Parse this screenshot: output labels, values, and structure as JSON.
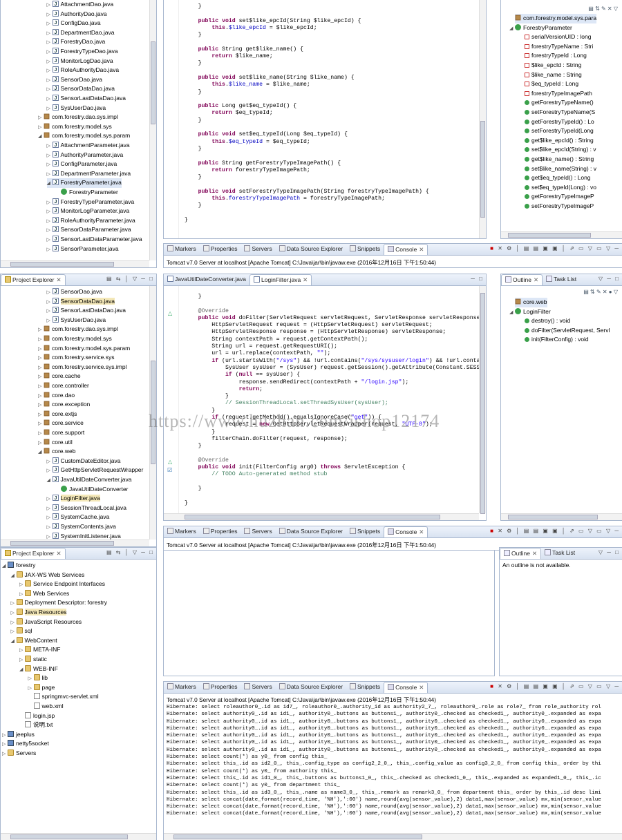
{
  "pe1": {
    "items": [
      {
        "label": "AttachmentDao.java",
        "type": "j",
        "indent": 5
      },
      {
        "label": "AuthorityDao.java",
        "type": "j",
        "indent": 5
      },
      {
        "label": "ConfigDao.java",
        "type": "j",
        "indent": 5
      },
      {
        "label": "DepartmentDao.java",
        "type": "j",
        "indent": 5
      },
      {
        "label": "ForestryDao.java",
        "type": "j",
        "indent": 5
      },
      {
        "label": "ForestryTypeDao.java",
        "type": "j",
        "indent": 5
      },
      {
        "label": "MonitorLogDao.java",
        "type": "j",
        "indent": 5
      },
      {
        "label": "RoleAuthorityDao.java",
        "type": "j",
        "indent": 5
      },
      {
        "label": "SensorDao.java",
        "type": "j",
        "indent": 5
      },
      {
        "label": "SensorDataDao.java",
        "type": "j",
        "indent": 5
      },
      {
        "label": "SensorLastDataDao.java",
        "type": "j",
        "indent": 5
      },
      {
        "label": "SysUserDao.java",
        "type": "j",
        "indent": 5
      },
      {
        "label": "com.forestry.dao.sys.impl",
        "type": "pk",
        "indent": 4
      },
      {
        "label": "com.forestry.model.sys",
        "type": "pk",
        "indent": 4
      },
      {
        "label": "com.forestry.model.sys.param",
        "type": "pk",
        "indent": 4,
        "open": true
      },
      {
        "label": "AttachmentParameter.java",
        "type": "j",
        "indent": 5
      },
      {
        "label": "AuthorityParameter.java",
        "type": "j",
        "indent": 5
      },
      {
        "label": "ConfigParameter.java",
        "type": "j",
        "indent": 5
      },
      {
        "label": "DepartmentParameter.java",
        "type": "j",
        "indent": 5
      },
      {
        "label": "ForestryParameter.java",
        "type": "j",
        "indent": 5,
        "open": true,
        "sel": true
      },
      {
        "label": "ForestryParameter",
        "type": "cls",
        "indent": 6
      },
      {
        "label": "ForestryTypeParameter.java",
        "type": "j",
        "indent": 5
      },
      {
        "label": "MonitorLogParameter.java",
        "type": "j",
        "indent": 5
      },
      {
        "label": "RoleAuthorityParameter.java",
        "type": "j",
        "indent": 5
      },
      {
        "label": "SensorDataParameter.java",
        "type": "j",
        "indent": 5
      },
      {
        "label": "SensorLastDataParameter.java",
        "type": "j",
        "indent": 5
      },
      {
        "label": "SensorParameter.java",
        "type": "j",
        "indent": 5
      }
    ]
  },
  "editor1": {
    "lines": [
      "    }",
      "",
      "    public void set$like_epcId(String $like_epcId) {",
      "        this.$like_epcId = $like_epcId;",
      "    }",
      "",
      "    public String get$like_name() {",
      "        return $like_name;",
      "    }",
      "",
      "    public void set$like_name(String $like_name) {",
      "        this.$like_name = $like_name;",
      "    }",
      "",
      "    public Long get$eq_typeId() {",
      "        return $eq_typeId;",
      "    }",
      "",
      "    public void set$eq_typeId(Long $eq_typeId) {",
      "        this.$eq_typeId = $eq_typeId;",
      "    }",
      "",
      "    public String getForestryTypeImagePath() {",
      "        return forestryTypeImagePath;",
      "    }",
      "",
      "    public void setForestryTypeImagePath(String forestryTypeImagePath) {",
      "        this.forestryTypeImagePath = forestryTypeImagePath;",
      "    }",
      "",
      "}"
    ]
  },
  "outline1": {
    "items": [
      {
        "label": "com.forestry.model.sys.para",
        "kind": "pkg",
        "indent": 0,
        "sel": true
      },
      {
        "label": "ForestryParameter",
        "kind": "cls",
        "indent": 0
      },
      {
        "label": "serialVersionUID : long",
        "kind": "fld",
        "indent": 1
      },
      {
        "label": "forestryTypeName : Stri",
        "kind": "fld",
        "indent": 1
      },
      {
        "label": "forestryTypeId : Long",
        "kind": "fld",
        "indent": 1
      },
      {
        "label": "$like_epcId : String",
        "kind": "fld",
        "indent": 1
      },
      {
        "label": "$like_name : String",
        "kind": "fld",
        "indent": 1
      },
      {
        "label": "$eq_typeId : Long",
        "kind": "fld",
        "indent": 1
      },
      {
        "label": "forestryTypeImagePath",
        "kind": "fld",
        "indent": 1
      },
      {
        "label": "getForestryTypeName()",
        "kind": "meth",
        "indent": 1
      },
      {
        "label": "setForestryTypeName(S",
        "kind": "meth",
        "indent": 1
      },
      {
        "label": "getForestryTypeId() : Lo",
        "kind": "meth",
        "indent": 1
      },
      {
        "label": "setForestryTypeId(Long",
        "kind": "meth",
        "indent": 1
      },
      {
        "label": "get$like_epcId() : String",
        "kind": "meth",
        "indent": 1
      },
      {
        "label": "set$like_epcId(String) : v",
        "kind": "meth",
        "indent": 1
      },
      {
        "label": "get$like_name() : String",
        "kind": "meth",
        "indent": 1
      },
      {
        "label": "set$like_name(String) : v",
        "kind": "meth",
        "indent": 1
      },
      {
        "label": "get$eq_typeId() : Long",
        "kind": "meth",
        "indent": 1
      },
      {
        "label": "set$eq_typeId(Long) : vo",
        "kind": "meth",
        "indent": 1
      },
      {
        "label": "getForestryTypeImageP",
        "kind": "meth",
        "indent": 1
      },
      {
        "label": "setForestryTypeImageP",
        "kind": "meth",
        "indent": 1
      }
    ]
  },
  "consoleTabs": [
    "Markers",
    "Properties",
    "Servers",
    "Data Source Explorer",
    "Snippets",
    "Console"
  ],
  "consoleHeader": "Tomcat v7.0 Server at localhost [Apache Tomcat] C:\\Java\\jar\\bin\\javaw.exe (2016年12月16日 下午1:50:44)",
  "pe2": {
    "title": "Project Explorer",
    "items": [
      {
        "label": "SensorDao.java",
        "type": "j",
        "indent": 5
      },
      {
        "label": "SensorDataDao.java",
        "type": "j",
        "indent": 5,
        "hl": true
      },
      {
        "label": "SensorLastDataDao.java",
        "type": "j",
        "indent": 5
      },
      {
        "label": "SysUserDao.java",
        "type": "j",
        "indent": 5
      },
      {
        "label": "com.forestry.dao.sys.impl",
        "type": "pk",
        "indent": 4
      },
      {
        "label": "com.forestry.model.sys",
        "type": "pk",
        "indent": 4
      },
      {
        "label": "com.forestry.model.sys.param",
        "type": "pk",
        "indent": 4
      },
      {
        "label": "com.forestry.service.sys",
        "type": "pk",
        "indent": 4
      },
      {
        "label": "com.forestry.service.sys.impl",
        "type": "pk",
        "indent": 4
      },
      {
        "label": "core.cache",
        "type": "pk",
        "indent": 4
      },
      {
        "label": "core.controller",
        "type": "pk",
        "indent": 4
      },
      {
        "label": "core.dao",
        "type": "pk",
        "indent": 4
      },
      {
        "label": "core.exception",
        "type": "pk",
        "indent": 4
      },
      {
        "label": "core.extjs",
        "type": "pk",
        "indent": 4
      },
      {
        "label": "core.service",
        "type": "pk",
        "indent": 4
      },
      {
        "label": "core.support",
        "type": "pk",
        "indent": 4
      },
      {
        "label": "core.util",
        "type": "pk",
        "indent": 4
      },
      {
        "label": "core.web",
        "type": "pk",
        "indent": 4,
        "open": true
      },
      {
        "label": "CustomDateEditor.java",
        "type": "j",
        "indent": 5
      },
      {
        "label": "GetHttpServletRequestWrapper",
        "type": "j",
        "indent": 5
      },
      {
        "label": "JavaUtilDateConverter.java",
        "type": "j",
        "indent": 5,
        "open": true
      },
      {
        "label": "JavaUtilDateConverter",
        "type": "cls",
        "indent": 6
      },
      {
        "label": "LoginFilter.java",
        "type": "j",
        "indent": 5,
        "hl": true
      },
      {
        "label": "SessionThreadLocal.java",
        "type": "j",
        "indent": 5
      },
      {
        "label": "SystemCache.java",
        "type": "j",
        "indent": 5
      },
      {
        "label": "SystemContents.java",
        "type": "j",
        "indent": 5
      },
      {
        "label": "SystemInitListener.java",
        "type": "j",
        "indent": 5
      }
    ]
  },
  "editor2": {
    "tabs": [
      "JavaUtilDateConverter.java",
      "LoginFilter.java"
    ],
    "lines": [
      "    }",
      "",
      "    @Override",
      "    public void doFilter(ServletRequest servletRequest, ServletResponse servletResponse, F",
      "        HttpServletRequest request = (HttpServletRequest) servletRequest;",
      "        HttpServletResponse response = (HttpServletResponse) servletResponse;",
      "        String contextPath = request.getContextPath();",
      "        String url = request.getRequestURI();",
      "        url = url.replace(contextPath, \"\");",
      "        if (url.startsWith(\"/sys\") && !url.contains(\"/sys/sysuser/login\") && !url.contains",
      "            SysUser sysUser = (SysUser) request.getSession().getAttribute(Constant.SESSION",
      "            if (null == sysUser) {",
      "                response.sendRedirect(contextPath + \"/login.jsp\");",
      "                return;",
      "            }",
      "            // SessionThreadLocal.setThreadSysUser(sysUser);",
      "        }",
      "        if (request.getMethod().equalsIgnoreCase(\"get\")) {",
      "            request = new GetHttpServletRequestWrapper(request, \"UTF-8\");",
      "        }",
      "        filterChain.doFilter(request, response);",
      "    }",
      "",
      "    @Override",
      "    public void init(FilterConfig arg0) throws ServletException {",
      "        // TODO Auto-generated method stub",
      "",
      "    }",
      "",
      "}"
    ]
  },
  "outline2": {
    "tabs": [
      "Outline",
      "Task List"
    ],
    "items": [
      {
        "label": "core.web",
        "kind": "pkg",
        "indent": 0,
        "sel": true
      },
      {
        "label": "LoginFilter",
        "kind": "cls",
        "indent": 0
      },
      {
        "label": "destroy() : void",
        "kind": "meth",
        "indent": 1
      },
      {
        "label": "doFilter(ServletRequest, Servl",
        "kind": "meth",
        "indent": 1
      },
      {
        "label": "init(FilterConfig) : void",
        "kind": "meth",
        "indent": 1
      }
    ]
  },
  "pe3": {
    "title": "Project Explorer",
    "items": [
      {
        "label": "forestry",
        "type": "pj",
        "indent": 0,
        "open": true
      },
      {
        "label": "JAX-WS Web Services",
        "type": "fd",
        "indent": 1,
        "open": true
      },
      {
        "label": "Service Endpoint Interfaces",
        "type": "fd",
        "indent": 2
      },
      {
        "label": "Web Services",
        "type": "fd",
        "indent": 2
      },
      {
        "label": "Deployment Descriptor: forestry",
        "type": "fd",
        "indent": 1
      },
      {
        "label": "Java Resources",
        "type": "fd",
        "indent": 1,
        "hl": true
      },
      {
        "label": "JavaScript Resources",
        "type": "fd",
        "indent": 1
      },
      {
        "label": "sql",
        "type": "fd",
        "indent": 1
      },
      {
        "label": "WebContent",
        "type": "fd",
        "indent": 1,
        "open": true
      },
      {
        "label": "META-INF",
        "type": "fd",
        "indent": 2
      },
      {
        "label": "static",
        "type": "fd",
        "indent": 2
      },
      {
        "label": "WEB-INF",
        "type": "fd",
        "indent": 2,
        "open": true
      },
      {
        "label": "lib",
        "type": "fd",
        "indent": 3
      },
      {
        "label": "page",
        "type": "fd",
        "indent": 3
      },
      {
        "label": "springmvc-servlet.xml",
        "type": "xml",
        "indent": 3
      },
      {
        "label": "web.xml",
        "type": "xml",
        "indent": 3
      },
      {
        "label": "login.jsp",
        "type": "xml",
        "indent": 2
      },
      {
        "label": "说明.txt",
        "type": "xml",
        "indent": 2
      },
      {
        "label": "jeeplus",
        "type": "pj",
        "indent": 0
      },
      {
        "label": "netty5socket",
        "type": "pj",
        "indent": 0
      },
      {
        "label": "Servers",
        "type": "fd",
        "indent": 0
      }
    ]
  },
  "outline3": {
    "tabs": [
      "Outline",
      "Task List"
    ],
    "message": "An outline is not available."
  },
  "console3": {
    "lines": [
      "Hibernate: select roleauthor0_.id as id7_, roleauthor0_.authority_id as authority2_7_, roleauthor0_.role as role7_ from role_authority rol",
      "Hibernate: select authority0_.id as id1_, authority0_.buttons as buttons1_, authority0_.checked as checked1_, authority0_.expanded as expa",
      "Hibernate: select authority0_.id as id1_, authority0_.buttons as buttons1_, authority0_.checked as checked1_, authority0_.expanded as expa",
      "Hibernate: select authority0_.id as id1_, authority0_.buttons as buttons1_, authority0_.checked as checked1_, authority0_.expanded as expa",
      "Hibernate: select authority0_.id as id1_, authority0_.buttons as buttons1_, authority0_.checked as checked1_, authority0_.expanded as expa",
      "Hibernate: select authority0_.id as id1_, authority0_.buttons as buttons1_, authority0_.checked as checked1_, authority0_.expanded as expa",
      "Hibernate: select authority0_.id as id1_, authority0_.buttons as buttons1_, authority0_.checked as checked1_, authority0_.expanded as expa",
      "Hibernate: select count(*) as y0_ from config this_",
      "Hibernate: select this_.id as id2_0_, this_.config_type as config2_2_0_, this_.config_value as config3_2_0_ from config this_ order by thi",
      "Hibernate: select count(*) as y0_ from authority this_",
      "Hibernate: select this_.id as id1_0_, this_.buttons as buttons1_0_, this_.checked as checked1_0_, this_.expanded as expanded1_0_, this_.ic",
      "Hibernate: select count(*) as y0_ from department this_",
      "Hibernate: select this_.id as id3_0_, this_.name as name3_0_, this_.remark as remark3_0_ from department this_ order by this_.id desc limi",
      "Hibernate: select concat(date_format(record_time, '%H'),':00') name,round(avg(sensor_value),2) data1,max(sensor_value) mx,min(sensor_value",
      "Hibernate: select concat(date_format(record_time, '%H'),':00') name,round(avg(sensor_value),2) data1,max(sensor_value) mx,min(sensor_value",
      "Hibernate: select concat(date_format(record_time, '%H'),':00') name,round(avg(sensor_value),2) data1,max(sensor_value) mx,min(sensor_value"
    ]
  },
  "watermark": "https://www.huzhan.com/ishop12174"
}
